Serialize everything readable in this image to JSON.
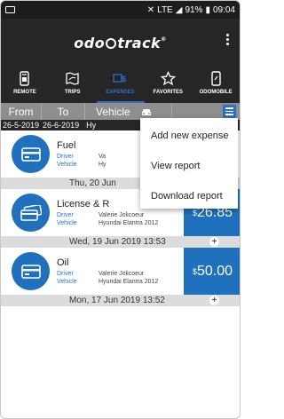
{
  "status_bar": {
    "signal_text": "LTE",
    "battery": "91%",
    "time": "09:04"
  },
  "app": {
    "logo_left": "odo",
    "logo_right": "track",
    "logo_tm": "®"
  },
  "tabs": [
    {
      "label": "REMOTE",
      "icon": "remote-icon",
      "active": false
    },
    {
      "label": "TRIPS",
      "icon": "map-icon",
      "active": false
    },
    {
      "label": "EXPENSES",
      "icon": "expenses-icon",
      "active": true
    },
    {
      "label": "FAVORITES",
      "icon": "star-icon",
      "active": false
    },
    {
      "label": "ODOMOBILE",
      "icon": "phone-icon",
      "active": false
    }
  ],
  "filter": {
    "from": "From",
    "to": "To",
    "vehicle": "Vehicle",
    "from_date": "26-5-2019",
    "to_date": "26-6-2019",
    "vehicle_value": "Hy"
  },
  "expenses": [
    {
      "title": "Fuel",
      "driver_label": "Driver",
      "driver": "Va",
      "vehicle_label": "Vehicle",
      "vehicle": "Hy",
      "price_symbol": "",
      "price": "",
      "icon": "credit-card-icon",
      "date": "Thu, 20 Jun"
    },
    {
      "title": "License & R",
      "driver_label": "Driver",
      "driver": "Valerie Jolicoeur",
      "vehicle_label": "Vehicle",
      "vehicle": "Hyundai Elantra 2012",
      "price_symbol": "$",
      "price": "26.85",
      "icon": "cards-icon",
      "date": "Wed, 19 Jun 2019 13:53"
    },
    {
      "title": "Oil",
      "driver_label": "Driver",
      "driver": "Valerie Jolicoeur",
      "vehicle_label": "Vehicle",
      "vehicle": "Hyundai Elantra 2012",
      "price_symbol": "$",
      "price": "50.00",
      "icon": "credit-card-icon",
      "date": "Mon, 17 Jun 2019 13:52"
    }
  ],
  "menu": {
    "items": [
      "Add new expense",
      "View report",
      "Download report"
    ]
  },
  "colors": {
    "accent": "#1f70bd",
    "bar_dark": "#262626",
    "filter_gray": "#8e8e8e"
  }
}
